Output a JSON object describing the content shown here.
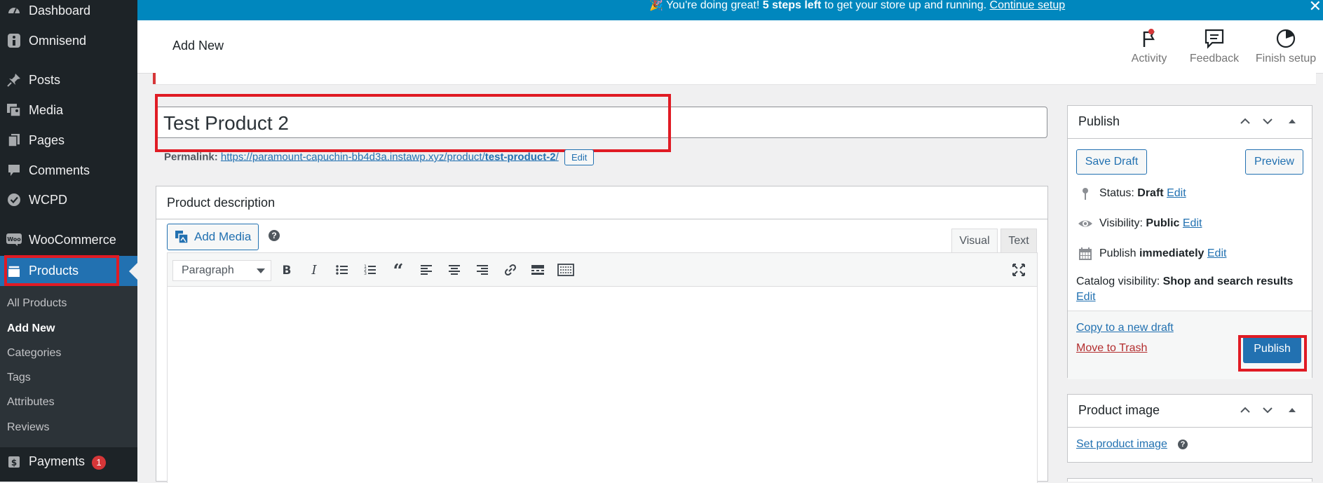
{
  "sidebar": {
    "items": [
      {
        "label": "Dashboard",
        "icon": "dashboard-icon"
      },
      {
        "label": "Omnisend",
        "icon": "omnisend-icon"
      },
      {
        "label": "Posts",
        "icon": "pin-icon"
      },
      {
        "label": "Media",
        "icon": "media-icon"
      },
      {
        "label": "Pages",
        "icon": "pages-icon"
      },
      {
        "label": "Comments",
        "icon": "comments-icon"
      },
      {
        "label": "WCPD",
        "icon": "check-circle-icon"
      },
      {
        "label": "WooCommerce",
        "icon": "woo-icon"
      },
      {
        "label": "Products",
        "icon": "products-icon"
      }
    ],
    "submenu": [
      "All Products",
      "Add New",
      "Categories",
      "Tags",
      "Attributes",
      "Reviews"
    ],
    "payments": {
      "label": "Payments",
      "badge": "1"
    }
  },
  "notice": {
    "emoji": "🎉",
    "text_before": "You're doing great!",
    "bold": "5 steps left",
    "text_after": "to get your store up and running.",
    "link": "Continue setup",
    "close": "✕"
  },
  "header": {
    "title": "Add New",
    "buttons": [
      {
        "label": "Activity",
        "icon": "flag-icon"
      },
      {
        "label": "Feedback",
        "icon": "feedback-icon"
      },
      {
        "label": "Finish setup",
        "icon": "progress-icon"
      }
    ]
  },
  "editor": {
    "title_value": "Test Product 2",
    "permalink_label": "Permalink:",
    "permalink_base": "https://paramount-capuchin-bb4d3a.instawp.xyz/product/",
    "permalink_slug": "test-product-2",
    "permalink_end": "/",
    "permalink_edit": "Edit",
    "desc_title": "Product description",
    "add_media": "Add Media",
    "help": "?",
    "tab_visual": "Visual",
    "tab_text": "Text",
    "format_value": "Paragraph"
  },
  "publish": {
    "title": "Publish",
    "save_draft": "Save Draft",
    "preview": "Preview",
    "status_label": "Status:",
    "status_value": "Draft",
    "visibility_label": "Visibility:",
    "visibility_value": "Public",
    "publish_label": "Publish",
    "publish_value": "immediately",
    "catalog_label": "Catalog visibility:",
    "catalog_value": "Shop and search results",
    "edit": "Edit",
    "copy_draft": "Copy to a new draft",
    "trash": "Move to Trash",
    "publish_button": "Publish"
  },
  "product_image": {
    "title": "Product image",
    "set_link": "Set product image",
    "help": "?"
  },
  "colors": {
    "sidebar_bg": "#1d2327",
    "accent": "#2271b1",
    "notice_bg": "#0087be",
    "highlight": "#e01b24"
  }
}
